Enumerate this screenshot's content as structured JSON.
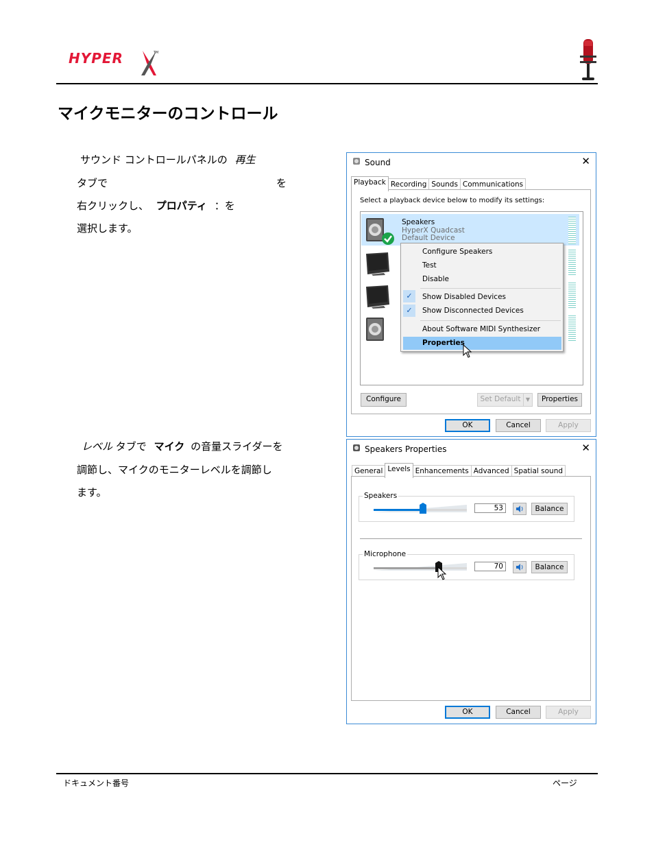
{
  "header": {
    "logo_text": "HYPERX",
    "logo_color": "#e31837",
    "title": "マイクモニターのコントロール"
  },
  "section1": {
    "line1_a": "サウンド コントロールパネルの",
    "line1_b": "再生",
    "line2_a": "タブで",
    "line2_b": "を",
    "line3_a": "右クリックし、",
    "line3_b": "プロパティ",
    "line3_c": "：を",
    "line4": "選択します。"
  },
  "section2": {
    "line1_a": "レベル",
    "line1_b": "タブで",
    "line1_c": "マイク",
    "line1_d": "の音量スライダーを",
    "line2": "調節し、マイクのモニターレベルを調節し",
    "line3": "ます。"
  },
  "sound_window": {
    "title": "Sound",
    "tabs": [
      "Playback",
      "Recording",
      "Sounds",
      "Communications"
    ],
    "instruction": "Select a playback device below to modify its settings:",
    "device_name": "Speakers",
    "device_model": "HyperX Quadcast",
    "device_status": "Default Device",
    "menu": {
      "configure": "Configure Speakers",
      "test": "Test",
      "disable": "Disable",
      "show_disabled": "Show Disabled Devices",
      "show_disconnected": "Show Disconnected Devices",
      "about": "About Software MIDI Synthesizer",
      "properties": "Properties"
    },
    "buttons": {
      "configure": "Configure",
      "set_default": "Set Default",
      "properties": "Properties",
      "ok": "OK",
      "cancel": "Cancel",
      "apply": "Apply"
    }
  },
  "props_window": {
    "title": "Speakers Properties",
    "tabs": [
      "General",
      "Levels",
      "Enhancements",
      "Advanced",
      "Spatial sound"
    ],
    "speakers": {
      "label": "Speakers",
      "value": "53",
      "balance": "Balance"
    },
    "microphone": {
      "label": "Microphone",
      "value": "70",
      "balance": "Balance"
    },
    "buttons": {
      "ok": "OK",
      "cancel": "Cancel",
      "apply": "Apply"
    }
  },
  "footer": {
    "left": "ドキュメント番号",
    "right": "ページ"
  },
  "colors": {
    "accent": "#0078d7",
    "selection": "#cce8ff",
    "menu_highlight": "#91c9f7"
  }
}
